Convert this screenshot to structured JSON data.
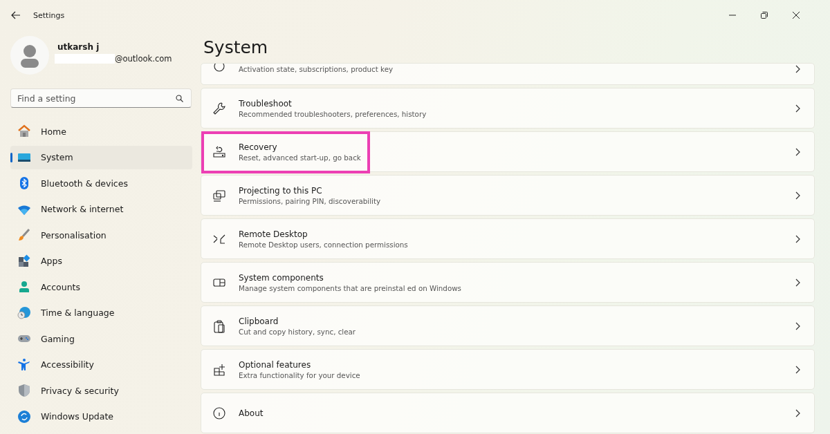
{
  "window": {
    "title": "Settings"
  },
  "account": {
    "name": "utkarsh j",
    "email": "@outlook.com"
  },
  "search": {
    "placeholder": "Find a setting"
  },
  "sidebar": {
    "items": [
      {
        "label": "Home",
        "selected": false
      },
      {
        "label": "System",
        "selected": true
      },
      {
        "label": "Bluetooth & devices",
        "selected": false
      },
      {
        "label": "Network & internet",
        "selected": false
      },
      {
        "label": "Personalisation",
        "selected": false
      },
      {
        "label": "Apps",
        "selected": false
      },
      {
        "label": "Accounts",
        "selected": false
      },
      {
        "label": "Time & language",
        "selected": false
      },
      {
        "label": "Gaming",
        "selected": false
      },
      {
        "label": "Accessibility",
        "selected": false
      },
      {
        "label": "Privacy & security",
        "selected": false
      },
      {
        "label": "Windows Update",
        "selected": false
      }
    ]
  },
  "page": {
    "title": "System"
  },
  "settings": [
    {
      "subtitle": "Activation state, subscriptions, product key",
      "highlighted": false
    },
    {
      "title": "Troubleshoot",
      "subtitle": "Recommended troubleshooters, preferences, history",
      "highlighted": false
    },
    {
      "title": "Recovery",
      "subtitle": "Reset, advanced start-up, go back",
      "highlighted": true
    },
    {
      "title": "Projecting to this PC",
      "subtitle": "Permissions, pairing PIN, discoverability",
      "highlighted": false
    },
    {
      "title": "Remote Desktop",
      "subtitle": "Remote Desktop users, connection permissions",
      "highlighted": false
    },
    {
      "title": "System components",
      "subtitle": "Manage system components that are preinstal ed on Windows",
      "highlighted": false
    },
    {
      "title": "Clipboard",
      "subtitle": "Cut and copy history, sync, clear",
      "highlighted": false
    },
    {
      "title": "Optional features",
      "subtitle": "Extra functionality for your device",
      "highlighted": false
    },
    {
      "title": "About",
      "highlighted": false
    }
  ]
}
